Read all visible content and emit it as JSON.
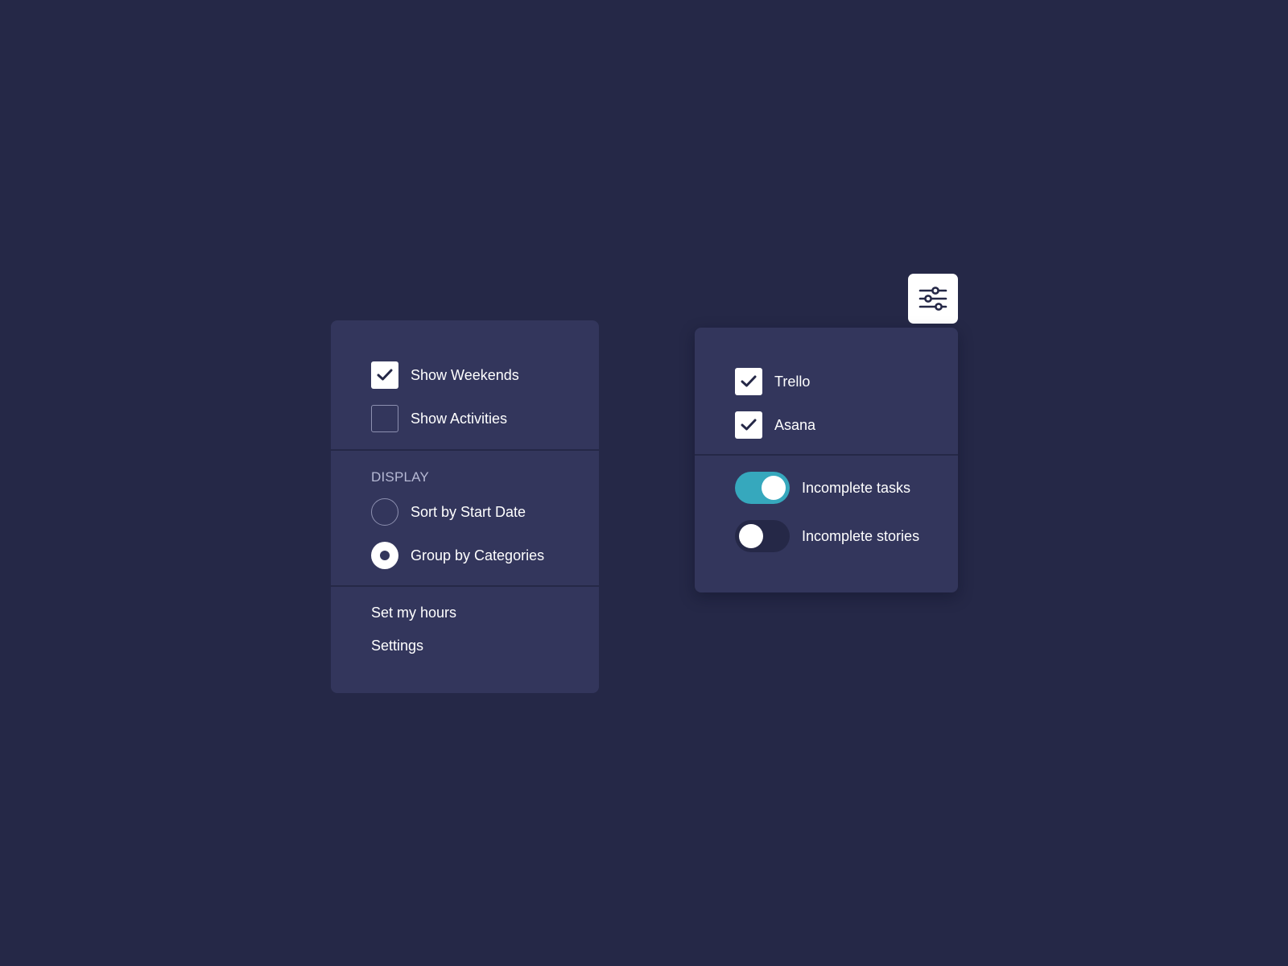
{
  "colors": {
    "background": "#252847",
    "panel": "#33365c",
    "toggle_on": "#36a8bd",
    "toggle_off": "#252847",
    "text": "#ffffff",
    "muted_text": "#b6b9d4"
  },
  "view_menu": {
    "checkboxes": [
      {
        "label": "Show Weekends",
        "checked": true
      },
      {
        "label": "Show Activities",
        "checked": false
      }
    ],
    "display": {
      "heading": "DISPLAY",
      "options": [
        {
          "label": "Sort by Start Date",
          "selected": false
        },
        {
          "label": "Group by Categories",
          "selected": true
        }
      ]
    },
    "links": [
      {
        "label": "Set my hours"
      },
      {
        "label": "Settings"
      }
    ]
  },
  "filter_menu": {
    "button_icon": "sliders-icon",
    "sources": [
      {
        "label": "Trello",
        "checked": true
      },
      {
        "label": "Asana",
        "checked": true
      }
    ],
    "toggles": [
      {
        "label": "Incomplete tasks",
        "on": true
      },
      {
        "label": "Incomplete stories",
        "on": false
      }
    ]
  }
}
